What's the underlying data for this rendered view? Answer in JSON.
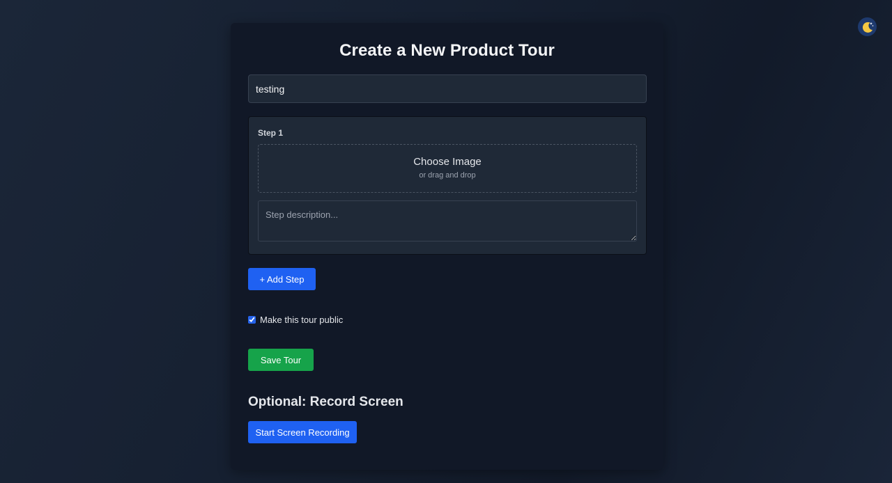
{
  "page": {
    "title": "Create a New Product Tour"
  },
  "tour": {
    "name_value": "testing"
  },
  "step": {
    "label": "Step 1",
    "choose_image": "Choose Image",
    "drag_hint": "or drag and drop",
    "description_placeholder": "Step description..."
  },
  "actions": {
    "add_step": "+ Add Step",
    "public_label": "Make this tour public",
    "public_checked": true,
    "save": "Save Tour"
  },
  "recording": {
    "heading": "Optional: Record Screen",
    "start": "Start Screen Recording"
  },
  "icons": {
    "theme_toggle": "moon-icon"
  },
  "colors": {
    "primary": "#1f61f2",
    "success": "#16a34a",
    "card": "#111827",
    "field": "#1f2937"
  }
}
